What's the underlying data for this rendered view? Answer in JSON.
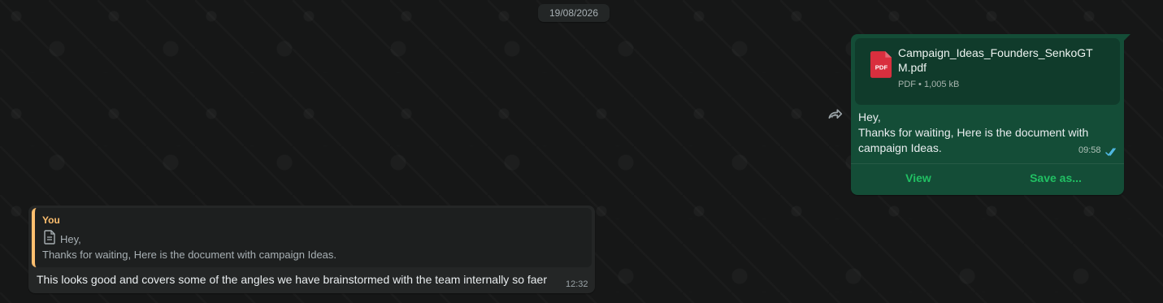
{
  "date_chip": "19/08/2026",
  "outgoing": {
    "file": {
      "name": "Campaign_Ideas_Founders_SenkoGTM.pdf",
      "meta": "PDF • 1,005 kB",
      "icon": "pdf-icon"
    },
    "message_lines": [
      "Hey,",
      "Thanks for waiting, Here is the document with",
      "campaign Ideas."
    ],
    "time": "09:58",
    "status_icon": "double-check-icon",
    "actions": {
      "view": "View",
      "save_as": "Save as..."
    },
    "forward_icon": "forward-icon"
  },
  "incoming": {
    "quote": {
      "author": "You",
      "line1": "Hey,",
      "line2": "Thanks for waiting, Here is the document with campaign Ideas.",
      "icon": "document-icon"
    },
    "text": "This looks good and covers some of the angles we have brainstormed with the team internally so faer",
    "time": "12:32"
  },
  "colors": {
    "background": "#161717",
    "outgoing_bubble": "#144d37",
    "incoming_bubble": "#242626",
    "accent_green": "#21c063",
    "quote_accent": "#fdbf6f",
    "pdf_red": "#d92f3e"
  }
}
